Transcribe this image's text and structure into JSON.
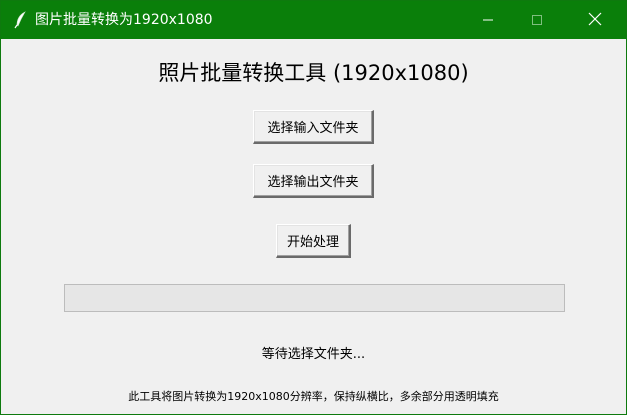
{
  "window": {
    "title": "图片批量转换为1920x1080",
    "titlebar_color": "#0a7f0a",
    "feather_icon": "feather-icon",
    "minimize_icon": "minimize-icon",
    "maximize_icon": "maximize-icon",
    "close_icon": "close-icon"
  },
  "main": {
    "title": "照片批量转换工具 (1920x1080)",
    "select_input_label": "选择输入文件夹",
    "select_output_label": "选择输出文件夹",
    "start_label": "开始处理",
    "progress_value": 0,
    "status_text": "等待选择文件夹...",
    "footer_text": "此工具将图片转换为1920x1080分辨率，保持纵横比，多余部分用透明填充"
  }
}
